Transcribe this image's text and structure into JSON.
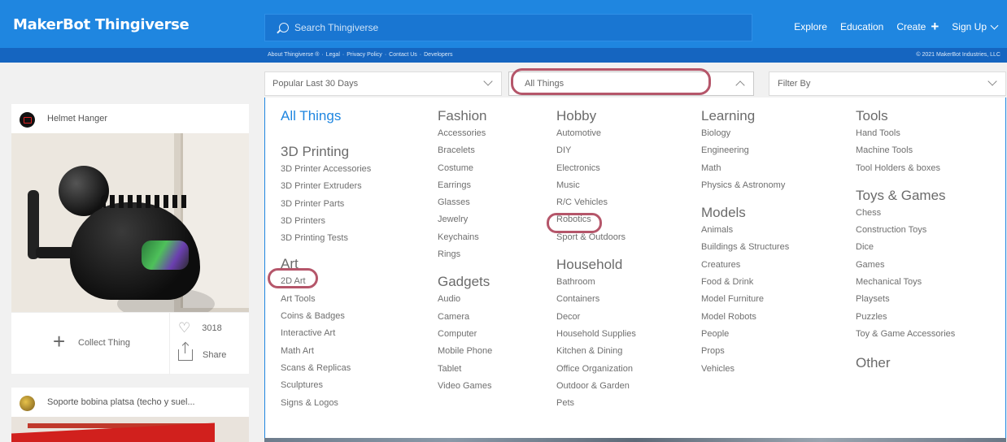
{
  "brand": {
    "maker": "MakerBot",
    "thingiverse": "Thingiverse"
  },
  "search": {
    "placeholder": "Search Thingiverse"
  },
  "nav": {
    "explore": "Explore",
    "education": "Education",
    "create": "Create",
    "signup": "Sign Up"
  },
  "sublinks": [
    "About Thingiverse ®",
    "·",
    "Legal",
    "·",
    "Privacy Policy",
    "·",
    "Contact Us",
    "·",
    "Developers"
  ],
  "copyright": "© 2021 MakerBot Industries, LLC",
  "filters": {
    "sort": "Popular Last 30 Days",
    "category": "All Things",
    "filter_by": "Filter By"
  },
  "cards": [
    {
      "title": "Helmet Hanger",
      "collect": "Collect Thing",
      "likes": "3018",
      "share": "Share"
    },
    {
      "title": "Soporte bobina platsa (techo y suel..."
    }
  ],
  "columns": [
    {
      "groups": [
        {
          "title": "All Things",
          "items": []
        },
        {
          "title": "3D Printing",
          "items": [
            "3D Printer Accessories",
            "3D Printer Extruders",
            "3D Printer Parts",
            "3D Printers",
            "3D Printing Tests"
          ]
        },
        {
          "title": "Art",
          "items": [
            "2D Art",
            "Art Tools",
            "Coins & Badges",
            "Interactive Art",
            "Math Art",
            "Scans & Replicas",
            "Sculptures",
            "Signs & Logos"
          ]
        }
      ]
    },
    {
      "groups": [
        {
          "title": "Fashion",
          "items": [
            "Accessories",
            "Bracelets",
            "Costume",
            "Earrings",
            "Glasses",
            "Jewelry",
            "Keychains",
            "Rings"
          ]
        },
        {
          "title": "Gadgets",
          "items": [
            "Audio",
            "Camera",
            "Computer",
            "Mobile Phone",
            "Tablet",
            "Video Games"
          ]
        }
      ]
    },
    {
      "groups": [
        {
          "title": "Hobby",
          "items": [
            "Automotive",
            "DIY",
            "Electronics",
            "Music",
            "R/C Vehicles",
            "Robotics",
            "Sport & Outdoors"
          ]
        },
        {
          "title": "Household",
          "items": [
            "Bathroom",
            "Containers",
            "Decor",
            "Household Supplies",
            "Kitchen & Dining",
            "Office Organization",
            "Outdoor & Garden",
            "Pets"
          ]
        }
      ]
    },
    {
      "groups": [
        {
          "title": "Learning",
          "items": [
            "Biology",
            "Engineering",
            "Math",
            "Physics & Astronomy"
          ]
        },
        {
          "title": "Models",
          "items": [
            "Animals",
            "Buildings & Structures",
            "Creatures",
            "Food & Drink",
            "Model Furniture",
            "Model Robots",
            "People",
            "Props",
            "Vehicles"
          ]
        }
      ]
    },
    {
      "groups": [
        {
          "title": "Tools",
          "items": [
            "Hand Tools",
            "Machine Tools",
            "Tool Holders & boxes"
          ]
        },
        {
          "title": "Toys & Games",
          "items": [
            "Chess",
            "Construction Toys",
            "Dice",
            "Games",
            "Mechanical Toys",
            "Playsets",
            "Puzzles",
            "Toy & Game Accessories"
          ]
        },
        {
          "title": "Other",
          "items": []
        }
      ]
    }
  ]
}
